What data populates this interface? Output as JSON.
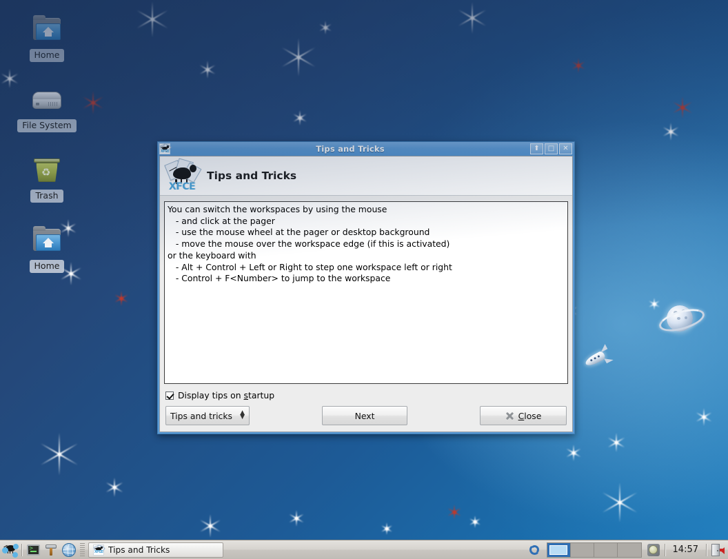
{
  "desktop": {
    "icons": [
      {
        "label": "Home",
        "icon": "folder-home-icon"
      },
      {
        "label": "File System",
        "icon": "hard-disk-icon"
      },
      {
        "label": "Trash",
        "icon": "trash-icon"
      },
      {
        "label": "Home",
        "icon": "folder-home-icon"
      }
    ],
    "wallpaper": {
      "name": "space-wallpaper",
      "elements": [
        "planet-icon",
        "rocket-icon",
        "star-icon"
      ],
      "colors": {
        "top": "#1f3a63",
        "bottom": "#1c7cbd",
        "star_white": "#ffffff",
        "star_red": "#c0392b"
      }
    }
  },
  "window": {
    "titlebar": {
      "title": "Tips and Tricks",
      "icon": "xfce-logo-icon",
      "buttons": [
        {
          "name": "shade-button",
          "glyph": "⬆"
        },
        {
          "name": "maximize-button",
          "glyph": "□"
        },
        {
          "name": "close-button",
          "glyph": "✕"
        }
      ],
      "color": "#5b9bd5"
    },
    "header": {
      "title": "Tips and Tricks",
      "logo": "xfce-logo-icon",
      "logo_word": "XFCE"
    },
    "tip_text": "You can switch the workspaces by using the mouse\n   - and click at the pager\n   - use the mouse wheel at the pager or desktop background\n   - move the mouse over the workspace edge (if this is activated)\nor the keyboard with\n   - Alt + Control + Left or Right to step one workspace left or right\n   - Control + F<Number> to jump to the workspace",
    "checkbox": {
      "label_before": "Display tips on ",
      "label_mnemonic": "s",
      "label_after": "tartup",
      "checked": true
    },
    "controls": {
      "category_value": "Tips and tricks",
      "category_options": [
        "Tips and tricks"
      ],
      "next_label": "Next",
      "close_label_mnemonic": "C",
      "close_label_rest": "lose"
    }
  },
  "panel": {
    "launchers": [
      {
        "name": "applications-menu-button",
        "icon": "xfce-mouse-icon"
      },
      {
        "name": "terminal-launcher",
        "icon": "terminal-icon"
      },
      {
        "name": "settings-launcher",
        "icon": "hammer-tool-icon"
      },
      {
        "name": "web-browser-launcher",
        "icon": "globe-icon"
      }
    ],
    "task_button": {
      "label": "Tips and Tricks",
      "icon": "xfce-logo-icon",
      "active": true
    },
    "tray": {
      "sync_icon": "sync-refresh-icon",
      "pager": {
        "count": 4,
        "active_index": 0
      },
      "show_desktop_icon": "show-desktop-icon",
      "clock": "14:57",
      "logout_icon": "logout-icon"
    }
  }
}
